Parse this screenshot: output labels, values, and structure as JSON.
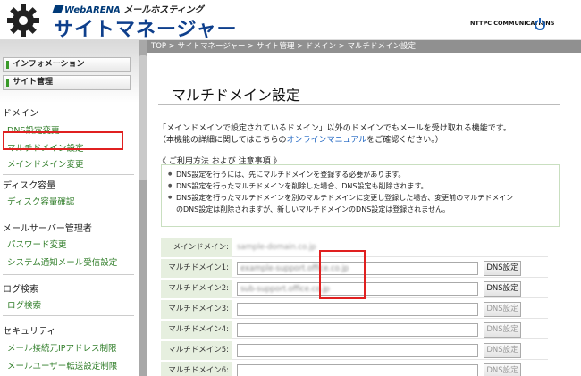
{
  "header": {
    "brand_top": "WebARENA",
    "brand_top_sub": "メールホスティング",
    "app_title": "サイトマネージャー",
    "company": "NTTPC COMMUNICATIONS",
    "logo_icon": "gear-icon",
    "logout_icon": "power-icon"
  },
  "breadcrumb": "TOP > サイトマネージャー > サイト管理 > ドメイン > マルチドメイン設定",
  "sidebar": {
    "buttons": [
      "インフォメーション",
      "サイト管理"
    ],
    "sections": [
      {
        "title": "ドメイン",
        "links": [
          "DNS設定変更",
          "マルチドメイン設定",
          "メインドメイン変更"
        ]
      },
      {
        "title": "ディスク容量",
        "links": [
          "ディスク容量確認"
        ]
      },
      {
        "title": "メールサーバー管理者",
        "links": [
          "パスワード変更",
          "システム通知メール受信設定"
        ]
      },
      {
        "title": "ログ検索",
        "links": [
          "ログ検索"
        ]
      },
      {
        "title": "セキュリティ",
        "links": [
          "メール接続元IPアドレス制限",
          "メールユーザー転送設定制限"
        ]
      }
    ]
  },
  "main": {
    "title": "マルチドメイン設定",
    "description_line1": "「メインドメインで設定されているドメイン」以外のドメインでもメールを受け取れる機能です。",
    "description_line2_pre": "（本機能の詳細に関してはこちらの",
    "description_link": "オンラインマニュアル",
    "description_line2_post": "をご確認ください。）",
    "notice_title": "《 ご利用方法 および 注意事項 》",
    "notices": [
      "DNS設定を行うには、先にマルチドメインを登録する必要があります。",
      "DNS設定を行ったマルチドメインを削除した場合、DNS設定も削除されます。",
      "DNS設定を行ったマルチドメインを別のマルチドメインに変更し登録した場合、変更前のマルチドメイン",
      "のDNS設定は削除されますが、新しいマルチドメインのDNS設定は登録されません。"
    ],
    "main_domain_label": "メインドメイン:",
    "main_domain_value": "sample-domain.co.jp",
    "rows": [
      {
        "label": "マルチドメイン1:",
        "value": "example-support.office.co.jp",
        "button": "DNS設定",
        "enabled": true
      },
      {
        "label": "マルチドメイン2:",
        "value": "sub-support.office.co.jp",
        "button": "DNS設定",
        "enabled": true
      },
      {
        "label": "マルチドメイン3:",
        "value": "",
        "button": "DNS設定",
        "enabled": false
      },
      {
        "label": "マルチドメイン4:",
        "value": "",
        "button": "DNS設定",
        "enabled": false
      },
      {
        "label": "マルチドメイン5:",
        "value": "",
        "button": "DNS設定",
        "enabled": false
      },
      {
        "label": "マルチドメイン6:",
        "value": "",
        "button": "DNS設定",
        "enabled": false
      }
    ]
  },
  "colors": {
    "brand_blue": "#0e3f8c",
    "link_green": "#2f7d28",
    "highlight_red": "#e02020",
    "label_bg": "#e6efdf"
  }
}
